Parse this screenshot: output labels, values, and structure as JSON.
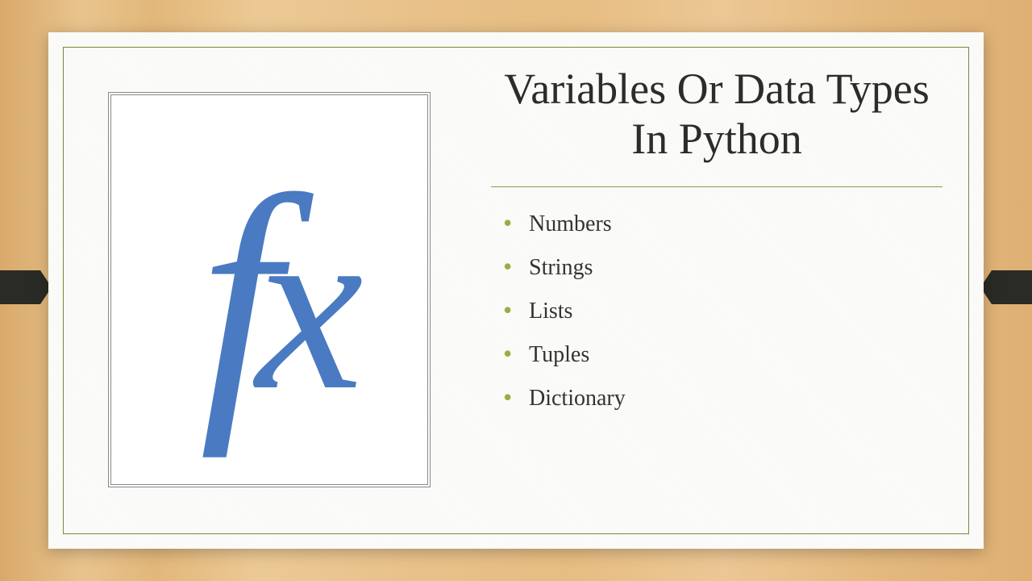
{
  "slide": {
    "title": "Variables Or Data Types In Python",
    "image_symbol_f": "f",
    "image_symbol_x": "x",
    "bullets": [
      "Numbers",
      "Strings",
      "Lists",
      "Tuples",
      "Dictionary"
    ]
  }
}
